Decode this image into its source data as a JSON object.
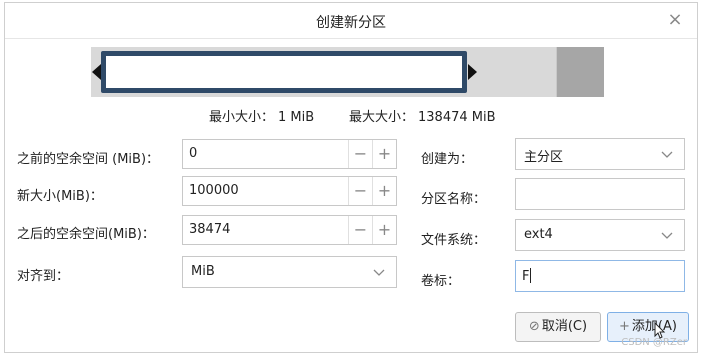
{
  "dialog": {
    "title": "创建新分区"
  },
  "sizes": {
    "min_label": "最小大小：",
    "min_value": "1 MiB",
    "max_label": "最大大小：",
    "max_value": "138474 MiB"
  },
  "fields": {
    "free_before": {
      "label": "之前的空余空间 (MiB)：",
      "value": "0"
    },
    "new_size": {
      "label": "新大小(MiB)：",
      "value": "100000"
    },
    "free_after": {
      "label": "之后的空余空间(MiB)：",
      "value": "38474"
    },
    "align": {
      "label": "对齐到：",
      "value": "MiB"
    }
  },
  "right": {
    "create_as": {
      "label": "创建为：",
      "value": "主分区"
    },
    "partition_name": {
      "label": "分区名称：",
      "value": ""
    },
    "filesystem": {
      "label": "文件系统：",
      "value": "ext4"
    },
    "volume_label": {
      "label": "卷标：",
      "value": "F"
    }
  },
  "spin": {
    "minus": "−",
    "plus": "+"
  },
  "buttons": {
    "cancel": "取消(C)",
    "add": "添加(A)"
  },
  "icons": {
    "close": "close-icon",
    "cancel": "no-entry-icon",
    "add": "plus-icon",
    "dropdown": "chevron-down-icon"
  },
  "colors": {
    "partition_border": "#2f4a68",
    "unallocated_after": "#a6a6a6",
    "bar_background": "#d9d9d9"
  },
  "watermark": "CSDN @RZer"
}
